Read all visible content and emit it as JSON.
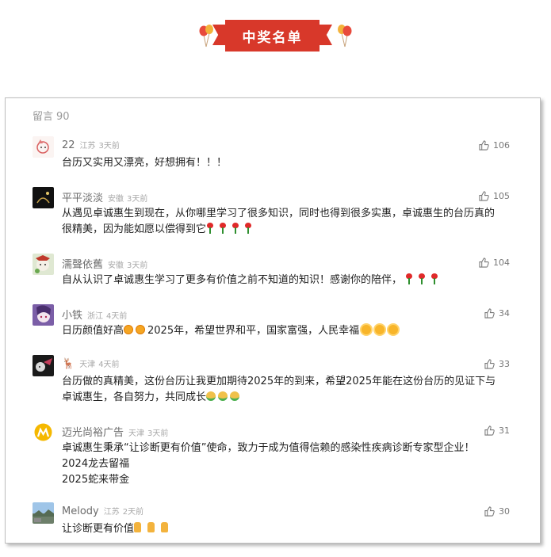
{
  "banner": {
    "title": "中奖名单"
  },
  "comments_header": {
    "label": "留言",
    "count": "90"
  },
  "comments": [
    {
      "nick": "22",
      "region": "江苏",
      "time": "3天前",
      "likes": "106",
      "lines": [
        "台历又实用又漂亮，好想拥有！！！"
      ]
    },
    {
      "nick": "平平淡淡",
      "region": "安徽",
      "time": "3天前",
      "likes": "105",
      "lines": [
        "从遇见卓诚惠生到现在，从你哪里学习了很多知识，同时也得到很多实惠，卓诚惠生的台历真的",
        "很精美，因为能如愿以偿得到它"
      ]
    },
    {
      "nick": "濡聲依舊",
      "region": "安徽",
      "time": "3天前",
      "likes": "104",
      "lines": [
        "自从认识了卓诚惠生学习了更多有价值之前不知道的知识！感谢你的陪伴，"
      ]
    },
    {
      "nick": "小铁",
      "region": "浙江",
      "time": "4天前",
      "likes": "34",
      "lines": [
        "日历颜值好高",
        "2025年，希望世界和平，国家富强，人民幸福"
      ]
    },
    {
      "nick": "🦌",
      "region": "天津",
      "time": "4天前",
      "likes": "33",
      "lines": [
        "台历做的真精美，这份台历让我更加期待2025年的到来，希望2025年能在这份台历的见证下与",
        "卓诚惠生，各自努力，共同成长"
      ]
    },
    {
      "nick": "迈光尚裕广告",
      "region": "天津",
      "time": "3天前",
      "likes": "31",
      "lines": [
        "卓诚惠生秉承“让诊断更有价值”使命，致力于成为值得信赖的感染性疾病诊断专家型企业！",
        "2024龙去留福",
        "2025蛇来带金"
      ]
    },
    {
      "nick": "Melody",
      "region": "江苏",
      "time": "2天前",
      "likes": "30",
      "lines": [
        "让诊断更有价值"
      ]
    }
  ]
}
